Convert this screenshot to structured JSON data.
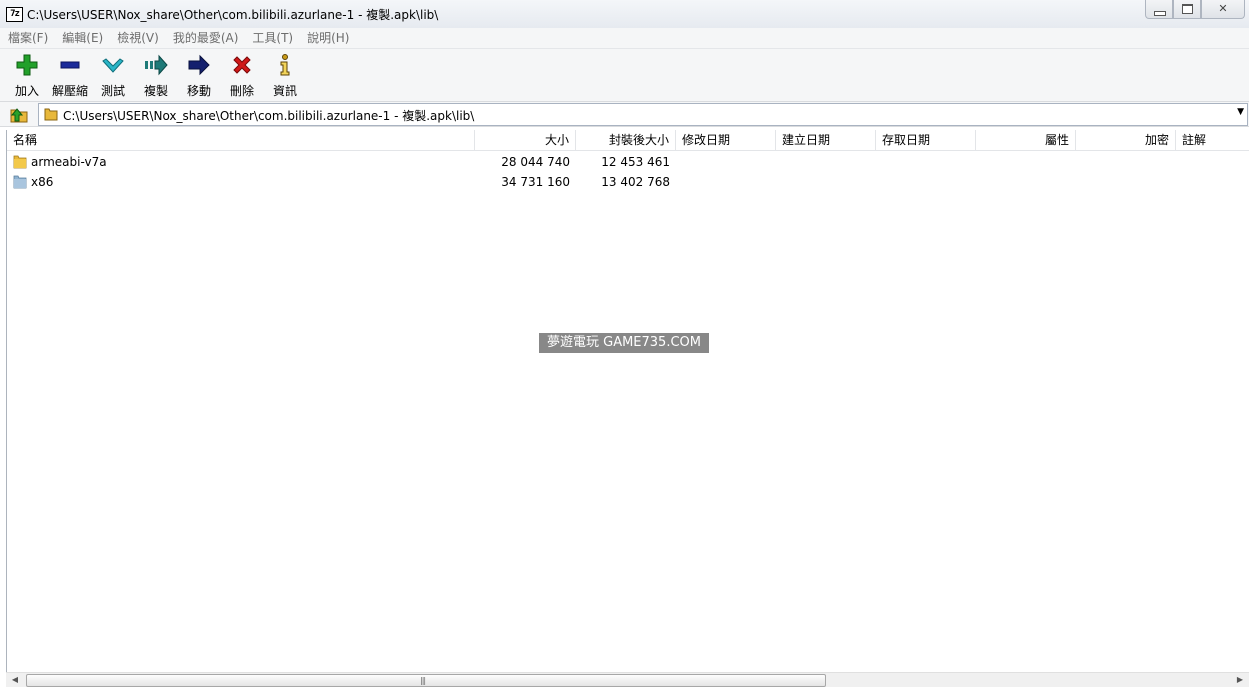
{
  "window": {
    "app_icon_text": "7z",
    "title": "C:\\Users\\USER\\Nox_share\\Other\\com.bilibili.azurlane-1 - 複製.apk\\lib\\",
    "close_glyph": "✕"
  },
  "menu": [
    {
      "label": "檔案(F)"
    },
    {
      "label": "編輯(E)"
    },
    {
      "label": "檢視(V)"
    },
    {
      "label": "我的最愛(A)"
    },
    {
      "label": "工具(T)"
    },
    {
      "label": "說明(H)"
    }
  ],
  "toolbar": {
    "add": "加入",
    "extract": "解壓縮",
    "test": "測試",
    "copy": "複製",
    "move": "移動",
    "delete": "刪除",
    "info": "資訊"
  },
  "address": {
    "path": "C:\\Users\\USER\\Nox_share\\Other\\com.bilibili.azurlane-1 - 複製.apk\\lib\\",
    "dropdown_glyph": "▼"
  },
  "columns": {
    "name": "名稱",
    "size": "大小",
    "packed_size": "封裝後大小",
    "modified": "修改日期",
    "created": "建立日期",
    "accessed": "存取日期",
    "attributes": "屬性",
    "encrypted": "加密",
    "comment": "註解"
  },
  "files": [
    {
      "name": "armeabi-v7a",
      "size": "28 044 740",
      "packed_size": "12 453 461",
      "icon": "folder-icon"
    },
    {
      "name": "x86",
      "size": "34 731 160",
      "packed_size": "13 402 768",
      "icon": "folder-icon"
    }
  ],
  "watermark": "夢遊電玩 GAME735.COM",
  "scrollbar": {
    "left_glyph": "◀",
    "right_glyph": "▶",
    "grip": "|||"
  },
  "colors": {
    "folder_yellow": "#e8b83a",
    "folder_blue": "#8fb2d0",
    "add_green": "#22a02a",
    "extract_blue": "#1a2a9a",
    "test_cyan": "#29b5c7",
    "copy_teal": "#1e7a78",
    "move_navy": "#14206e",
    "delete_red": "#d01818",
    "info_gold": "#c89a18"
  }
}
